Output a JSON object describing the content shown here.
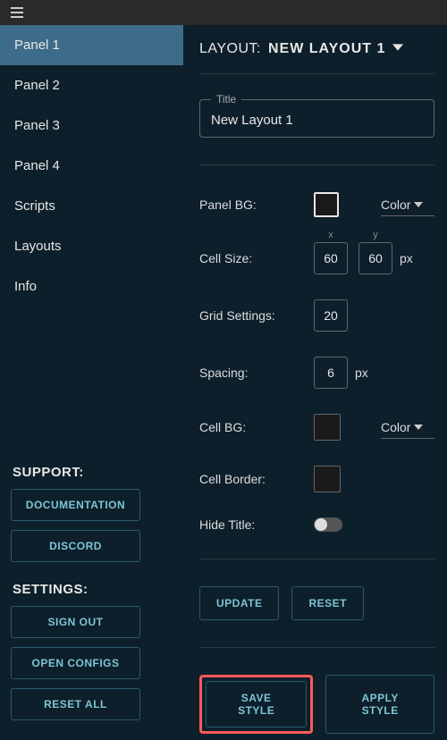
{
  "topbar": {
    "menu_icon": "hamburger-icon"
  },
  "sidebar": {
    "nav": [
      {
        "label": "Panel 1",
        "active": true
      },
      {
        "label": "Panel 2",
        "active": false
      },
      {
        "label": "Panel 3",
        "active": false
      },
      {
        "label": "Panel 4",
        "active": false
      },
      {
        "label": "Scripts",
        "active": false
      },
      {
        "label": "Layouts",
        "active": false
      },
      {
        "label": "Info",
        "active": false
      }
    ],
    "support": {
      "heading": "SUPPORT:",
      "buttons": {
        "documentation": "DOCUMENTATION",
        "discord": "DISCORD"
      }
    },
    "settings": {
      "heading": "SETTINGS:",
      "buttons": {
        "sign_out": "SIGN OUT",
        "open_configs": "OPEN CONFIGS",
        "reset_all": "RESET ALL"
      }
    }
  },
  "main": {
    "layout_header": {
      "label": "LAYOUT:",
      "value": "NEW LAYOUT 1"
    },
    "title_field": {
      "label": "Title",
      "value": "New Layout 1"
    },
    "panel_bg": {
      "label": "Panel BG:",
      "swatch_color": "#1a1a1a",
      "select_text": "Color"
    },
    "cell_size": {
      "label": "Cell Size:",
      "x_label": "x",
      "x": "60",
      "y_label": "y",
      "y": "60",
      "unit": "px"
    },
    "grid_settings": {
      "label": "Grid Settings:",
      "value": "20"
    },
    "spacing": {
      "label": "Spacing:",
      "value": "6",
      "unit": "px"
    },
    "cell_bg": {
      "label": "Cell BG:",
      "swatch_color": "#1a1a1a",
      "select_text": "Color"
    },
    "cell_border": {
      "label": "Cell Border:",
      "swatch_color": "#1a1a1a"
    },
    "hide_title": {
      "label": "Hide Title:",
      "value": false
    },
    "actions1": {
      "update": "UPDATE",
      "reset": "RESET"
    },
    "actions2": {
      "save_style": "SAVE STYLE",
      "apply_style": "APPLY STYLE"
    }
  }
}
